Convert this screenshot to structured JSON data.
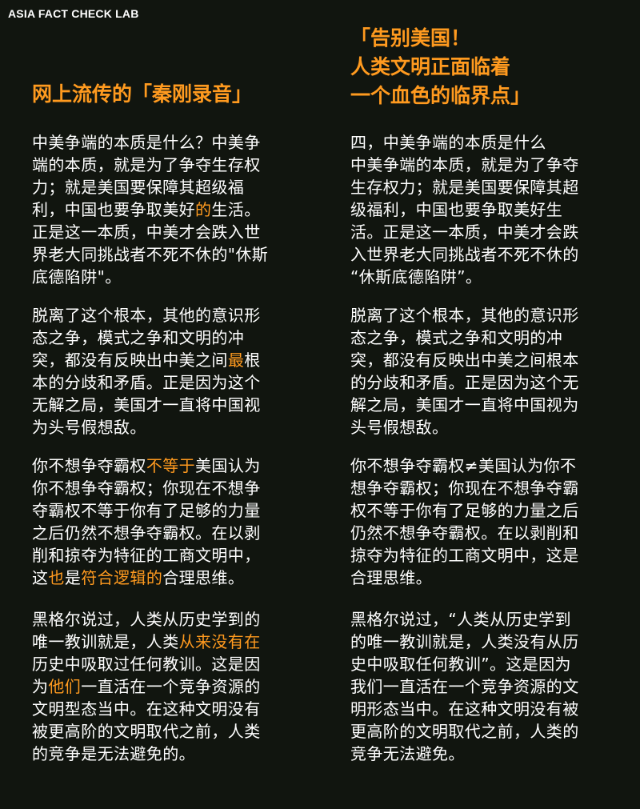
{
  "brand": "ASIA FACT CHECK LAB",
  "colors": {
    "background": "#11150f",
    "accent": "#ff9a1f",
    "text": "#ffffff"
  },
  "left": {
    "title": "网上流传的「秦刚录音」",
    "paragraphs": [
      {
        "lines": [
          [
            {
              "t": "中美争端的本质是什么？中美争"
            }
          ],
          [
            {
              "t": "端的本质，就是为了争夺生存权"
            }
          ],
          [
            {
              "t": "力；就是美国要保障其超级福"
            }
          ],
          [
            {
              "t": "利，中国也要争取美好"
            },
            {
              "t": "的",
              "hl": true
            },
            {
              "t": "生活。"
            }
          ],
          [
            {
              "t": "正是这一本质，中美才会跌入世"
            }
          ],
          [
            {
              "t": "界老大同挑战者不死不休的\"休斯"
            }
          ],
          [
            {
              "t": "底德陷阱\"。"
            }
          ]
        ]
      },
      {
        "lines": [
          [
            {
              "t": "脱离了这个根本，其他的意识形"
            }
          ],
          [
            {
              "t": "态之争，模式之争和文明的冲"
            }
          ],
          [
            {
              "t": "突，都没有反映出中美之间"
            },
            {
              "t": "最",
              "hl": true
            },
            {
              "t": "根"
            }
          ],
          [
            {
              "t": "本的分歧和矛盾。正是因为这个"
            }
          ],
          [
            {
              "t": "无解之局，美国才一直将中国视"
            }
          ],
          [
            {
              "t": "为头号假想敌。"
            }
          ]
        ]
      },
      {
        "lines": [
          [
            {
              "t": "你不想争夺霸权"
            },
            {
              "t": "不等于",
              "hl": true
            },
            {
              "t": "美国认为"
            }
          ],
          [
            {
              "t": "你不想争夺霸权；你现在不想争"
            }
          ],
          [
            {
              "t": "夺霸权不等于你有了足够的力量"
            }
          ],
          [
            {
              "t": "之后仍然不想争夺霸权。在以剥"
            }
          ],
          [
            {
              "t": "削和掠夺为特征的工商文明中，"
            }
          ],
          [
            {
              "t": "这"
            },
            {
              "t": "也",
              "hl": true
            },
            {
              "t": "是"
            },
            {
              "t": "符合逻辑的",
              "hl": true
            },
            {
              "t": "合理思维。"
            }
          ]
        ]
      },
      {
        "lines": [
          [
            {
              "t": "黑格尔说过，人类从历史学到的"
            }
          ],
          [
            {
              "t": "唯一教训就是，人类"
            },
            {
              "t": "从来没有在",
              "hl": true
            }
          ],
          [
            {
              "t": "历史中吸取过任何教训。这是因"
            }
          ],
          [
            {
              "t": "为"
            },
            {
              "t": "他们",
              "hl": true
            },
            {
              "t": "一直活在一个竞争资源的"
            }
          ],
          [
            {
              "t": "文明型态当中。在这种文明没有"
            }
          ],
          [
            {
              "t": "被更高阶的文明取代之前，人类"
            }
          ],
          [
            {
              "t": "的竞争是无法避免的。"
            }
          ]
        ]
      }
    ]
  },
  "right": {
    "title_lines": [
      "「告别美国！",
      "人类文明正面临着",
      "一个血色的临界点」"
    ],
    "paragraphs": [
      {
        "lines": [
          [
            {
              "t": "四，中美争端的本质是什么"
            }
          ],
          [
            {
              "t": "中美争端的本质，就是为了争夺"
            }
          ],
          [
            {
              "t": "生存权力；就是美国要保障其超"
            }
          ],
          [
            {
              "t": "级福利，中国也要争取美好生"
            }
          ],
          [
            {
              "t": "活。正是这一本质，中美才会跌"
            }
          ],
          [
            {
              "t": "入世界老大同挑战者不死不休的"
            }
          ],
          [
            {
              "t": "“休斯底德陷阱”。"
            }
          ]
        ]
      },
      {
        "lines": [
          [
            {
              "t": "脱离了这个根本，其他的意识形"
            }
          ],
          [
            {
              "t": "态之争，模式之争和文明的冲"
            }
          ],
          [
            {
              "t": "突，都没有反映出中美之间根本"
            }
          ],
          [
            {
              "t": "的分歧和矛盾。正是因为这个无"
            }
          ],
          [
            {
              "t": "解之局，美国才一直将中国视为"
            }
          ],
          [
            {
              "t": "头号假想敌。"
            }
          ]
        ]
      },
      {
        "lines": [
          [
            {
              "t": "你不想争夺霸权≠美国认为你不"
            }
          ],
          [
            {
              "t": "想争夺霸权；你现在不想争夺霸"
            }
          ],
          [
            {
              "t": "权不等于你有了足够的力量之后"
            }
          ],
          [
            {
              "t": "仍然不想争夺霸权。在以剥削和"
            }
          ],
          [
            {
              "t": "掠夺为特征的工商文明中，这是"
            }
          ],
          [
            {
              "t": "合理思维。"
            }
          ]
        ]
      },
      {
        "lines": [
          [
            {
              "t": "黑格尔说过，“人类从历史学到"
            }
          ],
          [
            {
              "t": "的唯一教训就是，人类没有从历"
            }
          ],
          [
            {
              "t": "史中吸取任何教训”。这是因为"
            }
          ],
          [
            {
              "t": "我们一直活在一个竞争资源的文"
            }
          ],
          [
            {
              "t": "明形态当中。在这种文明没有被"
            }
          ],
          [
            {
              "t": "更高阶的文明取代之前，人类的"
            }
          ],
          [
            {
              "t": "竞争无法避免。"
            }
          ]
        ]
      }
    ]
  }
}
